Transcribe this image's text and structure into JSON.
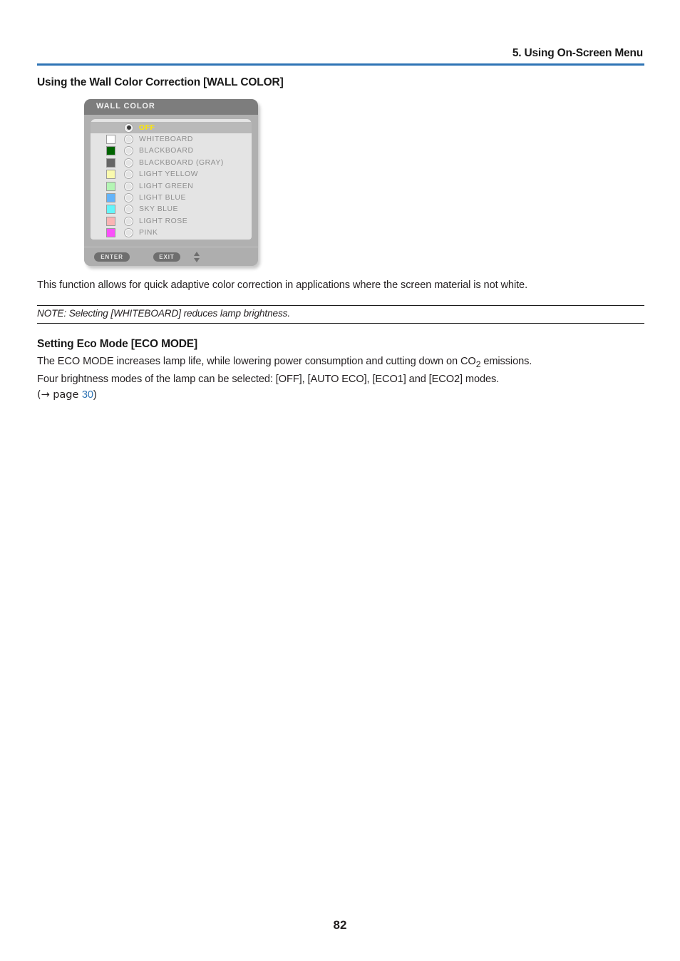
{
  "header": {
    "chapter_title": "5. Using On-Screen Menu"
  },
  "sections": {
    "wall_color": {
      "heading": "Using the Wall Color Correction [WALL COLOR]",
      "paragraph": "This function allows for quick adaptive color correction in applications where the screen material is not white.",
      "note": "NOTE: Selecting [WHITEBOARD] reduces lamp brightness."
    },
    "eco_mode": {
      "heading": "Setting Eco Mode [ECO MODE]",
      "line1_a": "The ECO MODE increases lamp life, while lowering power consumption and cutting down on CO",
      "line1_sub": "2",
      "line1_b": " emissions.",
      "line2": "Four brightness modes of the lamp can be selected: [OFF], [AUTO ECO], [ECO1] and [ECO2] modes.",
      "line3_prefix": "(→ page ",
      "line3_page": "30",
      "line3_suffix": ")"
    }
  },
  "osd": {
    "title": "WALL COLOR",
    "rows": [
      {
        "label": "OFF",
        "swatch": null,
        "selected": true
      },
      {
        "label": "WHITEBOARD",
        "swatch": "#ffffff",
        "selected": false
      },
      {
        "label": "BLACKBOARD",
        "swatch": "#006400",
        "selected": false
      },
      {
        "label": "BLACKBOARD (GRAY)",
        "swatch": "#666666",
        "selected": false
      },
      {
        "label": "LIGHT YELLOW",
        "swatch": "#fafaae",
        "selected": false
      },
      {
        "label": "LIGHT GREEN",
        "swatch": "#b4f5b4",
        "selected": false
      },
      {
        "label": "LIGHT BLUE",
        "swatch": "#64b4fa",
        "selected": false
      },
      {
        "label": "SKY BLUE",
        "swatch": "#64f5fa",
        "selected": false
      },
      {
        "label": "LIGHT ROSE",
        "swatch": "#fab4b4",
        "selected": false
      },
      {
        "label": "PINK",
        "swatch": "#fa50fa",
        "selected": false
      }
    ],
    "footer": {
      "enter_label": "ENTER",
      "exit_label": "EXIT"
    }
  },
  "footer": {
    "page_number": "82"
  },
  "colors": {
    "rule_blue": "#2e74b5",
    "link_blue": "#2e74b5",
    "osd_highlight_text": "#ffe800",
    "osd_titlebar": "#7d7d7d",
    "osd_body": "#e4e4e4"
  }
}
